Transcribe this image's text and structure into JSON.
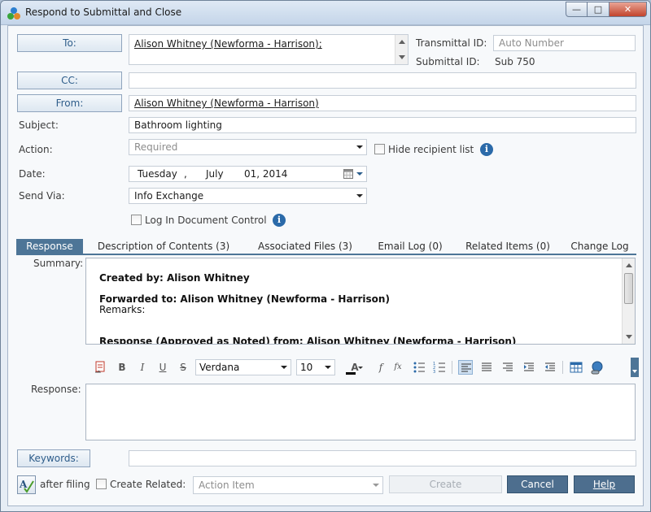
{
  "window": {
    "title": "Respond to Submittal and Close",
    "minimize_glyph": "—",
    "maximize_glyph": "□",
    "close_glyph": "✕"
  },
  "form": {
    "to_label": "To:",
    "to_value": "Alison Whitney (Newforma - Harrison);",
    "cc_label": "CC:",
    "cc_value": "",
    "from_label": "From:",
    "from_value": "Alison Whitney (Newforma - Harrison)",
    "subject_label": "Subject:",
    "subject_value": "Bathroom lighting",
    "action_label": "Action:",
    "action_placeholder": "Required",
    "hide_recipient_label": "Hide recipient list",
    "date_label": "Date:",
    "date_day": "Tuesday",
    "date_sep": ",",
    "date_month": "July",
    "date_rest": "01, 2014",
    "send_via_label": "Send Via:",
    "send_via_value": "Info Exchange",
    "log_in_doc_label": "Log In Document Control",
    "transmittal_id_label": "Transmittal ID:",
    "transmittal_id_placeholder": "Auto Number",
    "submittal_id_label": "Submittal ID:",
    "submittal_id_value": "Sub 750"
  },
  "tabs": [
    {
      "label": "Response"
    },
    {
      "label": "Description of Contents (3)"
    },
    {
      "label": "Associated Files (3)"
    },
    {
      "label": "Email Log (0)"
    },
    {
      "label": "Related Items (0)"
    },
    {
      "label": "Change Log"
    }
  ],
  "summary": {
    "label": "Summary:",
    "created_by": "Created by: Alison Whitney",
    "forwarded_to": "Forwarded to: Alison Whitney (Newforma - Harrison)",
    "remarks": "Remarks:",
    "response_from": "Response (Approved as Noted) from: Alison Whitney (Newforma - Harrison)"
  },
  "toolbar": {
    "bold": "B",
    "italic": "I",
    "underline": "U",
    "strike": "S",
    "font_family": "Verdana",
    "font_size": "10",
    "font_color_glyph": "A",
    "func_glyph": "f",
    "fx_glyph": "fx"
  },
  "response": {
    "label": "Response:",
    "value": ""
  },
  "footer": {
    "keywords_label": "Keywords:",
    "keywords_value": "",
    "after_filing_label": "after filing",
    "create_related_label": "Create Related:",
    "create_related_placeholder": "Action Item",
    "create_label": "Create",
    "cancel_label": "Cancel",
    "help_label": "Help"
  },
  "colors": {
    "accent": "#4d7597",
    "button": "#4d6e8e",
    "info_icon": "#2b6aa9"
  }
}
